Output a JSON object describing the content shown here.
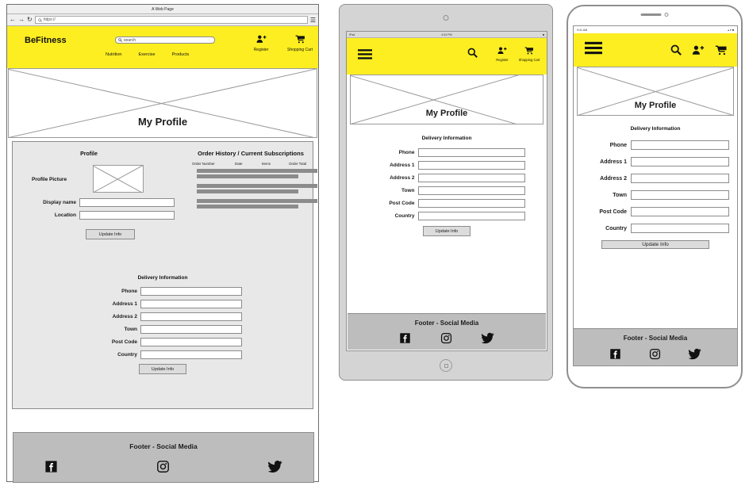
{
  "brand": "BeFitness",
  "theme": {
    "accent": "#fcee21",
    "placeholder_line": "#9a9a9a",
    "footer_bg": "#bdbdbd",
    "panel_bg": "#e8e8e8"
  },
  "browser": {
    "window_title": "A Web Page",
    "url_value": "https://",
    "back_icon": "arrow-left-icon",
    "forward_icon": "arrow-right-icon",
    "reload_icon": "reload-icon",
    "menu_icon": "hamburger-menu-icon"
  },
  "header": {
    "search_placeholder": "search",
    "search_icon": "search-icon",
    "register_label": "Register",
    "register_icon": "user-add-icon",
    "cart_label": "Shopping Cart",
    "cart_icon": "shopping-cart-icon",
    "menu_icon": "hamburger-menu-icon",
    "nav": [
      "Nutrition",
      "Exercise",
      "Products"
    ]
  },
  "hero": {
    "title": "My Profile"
  },
  "profile": {
    "section_title": "Profile",
    "picture_label": "Profile Picture",
    "fields": [
      {
        "label": "Display name",
        "value": ""
      },
      {
        "label": "Location",
        "value": ""
      }
    ],
    "update_label": "Update Info"
  },
  "orders": {
    "section_title": "Order History / Current Subscriptions",
    "columns": [
      "Order Number",
      "Date",
      "Items",
      "Order Total"
    ],
    "row_groups": 3
  },
  "delivery": {
    "section_title": "Delivery Information",
    "fields": [
      {
        "label": "Phone",
        "value": ""
      },
      {
        "label": "Address 1",
        "value": ""
      },
      {
        "label": "Address 2",
        "value": ""
      },
      {
        "label": "Town",
        "value": ""
      },
      {
        "label": "Post Code",
        "value": ""
      },
      {
        "label": "Country",
        "value": ""
      }
    ],
    "update_label": "Update Info"
  },
  "footer": {
    "title": "Footer - Social Media",
    "social": [
      "facebook-icon",
      "instagram-icon",
      "twitter-icon"
    ]
  },
  "tablet": {
    "status_left": "iPad",
    "status_time": "4:34 PM",
    "wifi_icon": "wifi-icon",
    "battery_icon": "battery-icon",
    "home_button_icon": "home-button-icon"
  },
  "phone": {
    "status_time": "9:41 AM",
    "signal_icon": "signal-icon",
    "wifi_icon": "wifi-icon",
    "battery_icon": "battery-icon"
  }
}
